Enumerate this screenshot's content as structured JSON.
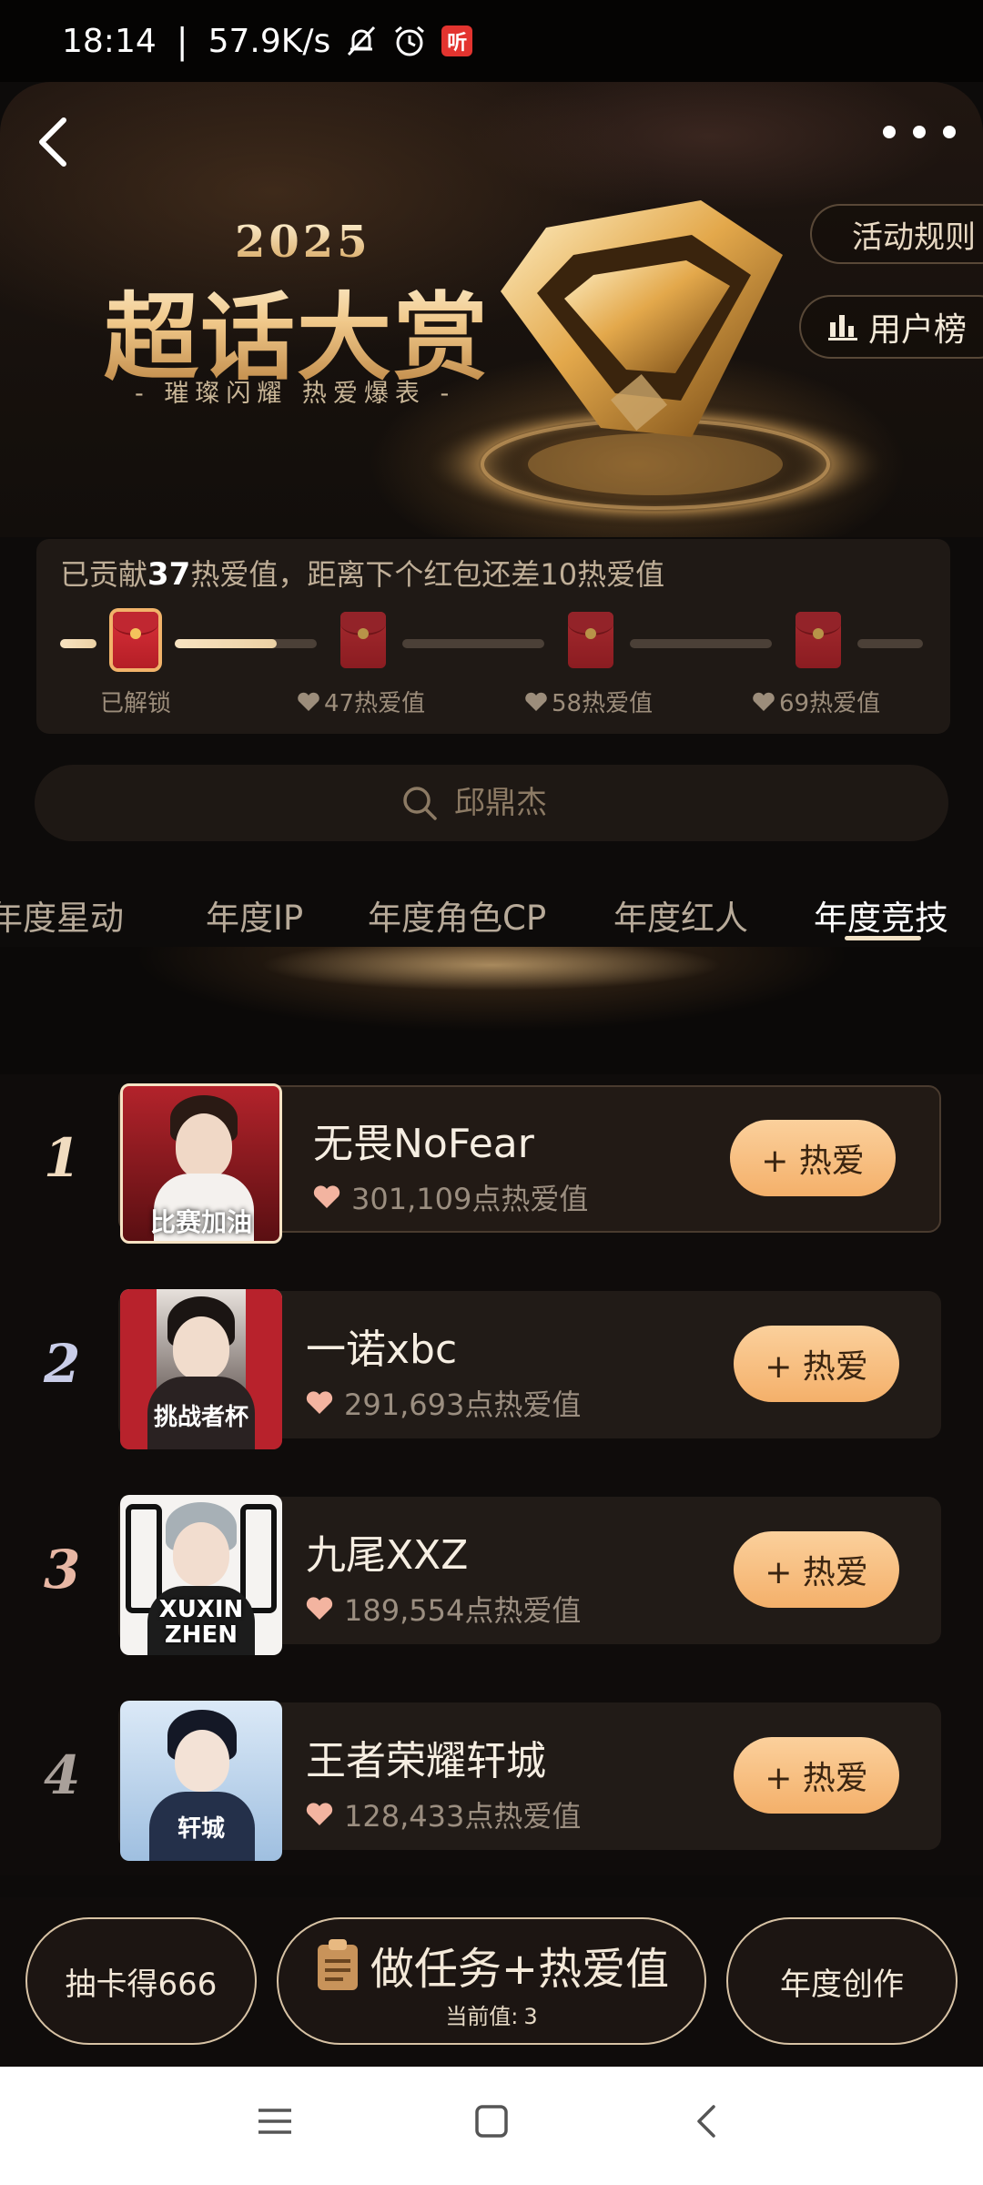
{
  "status_bar": {
    "time": "18:14",
    "separator": "|",
    "net_speed": "57.9K/s",
    "app_badge": "听"
  },
  "hero": {
    "year": "2025",
    "title": "超话大赏",
    "subtitle": "- 璀璨闪耀  热爱爆表 -",
    "rules_label": "活动规则",
    "users_label": "用户榜"
  },
  "contribution": {
    "text_prefix": "已贡献",
    "value": "37",
    "text_suffix": "热爱值，距离下个红包还差10热爱值",
    "milestones": [
      {
        "label": "已解锁",
        "status": "unlocked"
      },
      {
        "label": "47热爱值",
        "status": "locked"
      },
      {
        "label": "58热爱值",
        "status": "locked"
      },
      {
        "label": "69热爱值",
        "status": "locked"
      }
    ]
  },
  "search": {
    "placeholder": "邱鼎杰"
  },
  "tabs": [
    {
      "label": "年度星动",
      "active": false
    },
    {
      "label": "年度IP",
      "active": false
    },
    {
      "label": "年度角色CP",
      "active": false
    },
    {
      "label": "年度红人",
      "active": false
    },
    {
      "label": "年度竞技",
      "active": true
    }
  ],
  "ranking": [
    {
      "rank": "1",
      "name": "无畏NoFear",
      "hot": "301,109点热爱值",
      "avatar_text": "比赛加油",
      "button": "+ 热爱"
    },
    {
      "rank": "2",
      "name": "一诺xbc",
      "hot": "291,693点热爱值",
      "avatar_text": "挑战者杯",
      "button": "+ 热爱"
    },
    {
      "rank": "3",
      "name": "九尾XXZ",
      "hot": "189,554点热爱值",
      "avatar_text": "XUXIN ZHEN",
      "button": "+ 热爱"
    },
    {
      "rank": "4",
      "name": "王者荣耀轩城",
      "hot": "128,433点热爱值",
      "avatar_text": "轩城",
      "button": "+ 热爱"
    }
  ],
  "rank_colors": [
    "#f1dcc0",
    "#c9cde8",
    "#e8b7a4",
    "#a9a09a"
  ],
  "actions": {
    "draw_card": "抽卡得666",
    "task_label": "做任务+热爱值",
    "current_label": "当前值:",
    "current_value": "3",
    "annual_creation": "年度创作"
  },
  "colors": {
    "accent": "#f4b06a",
    "background": "#0d0b0a",
    "card": "#211b17"
  },
  "icons": {
    "back": "back-arrow-icon",
    "more": "more-dots-icon",
    "users": "bar-chart-icon",
    "search": "search-icon",
    "heart": "heart-icon",
    "task": "task-clipboard-icon"
  }
}
